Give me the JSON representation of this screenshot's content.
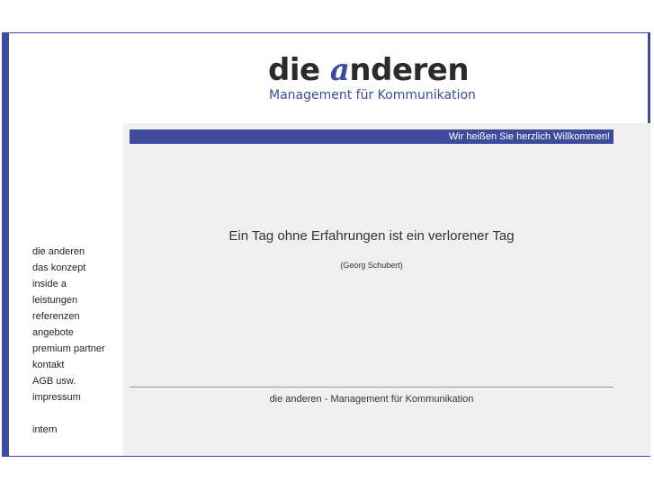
{
  "logo": {
    "word_prefix": "die ",
    "word_mark": "a",
    "word_suffix": "nderen",
    "subtitle": "Management für Kommunikation"
  },
  "welcome": "Wir heißen Sie herzlich Willkommen!",
  "quote": {
    "text": "Ein Tag ohne Erfahrungen ist ein verlorener Tag",
    "author": "(Georg Schubert)"
  },
  "footer": "die anderen - Management für Kommunikation",
  "nav": {
    "items": [
      "die anderen",
      "das konzept",
      "inside a",
      "leistungen",
      "referenzen",
      "angebote",
      "premium partner",
      "kontakt",
      "AGB usw.",
      "impressum"
    ],
    "intern": "intern"
  },
  "colors": {
    "brand_blue": "#3c4b9c",
    "panel_gray": "#efefef"
  }
}
